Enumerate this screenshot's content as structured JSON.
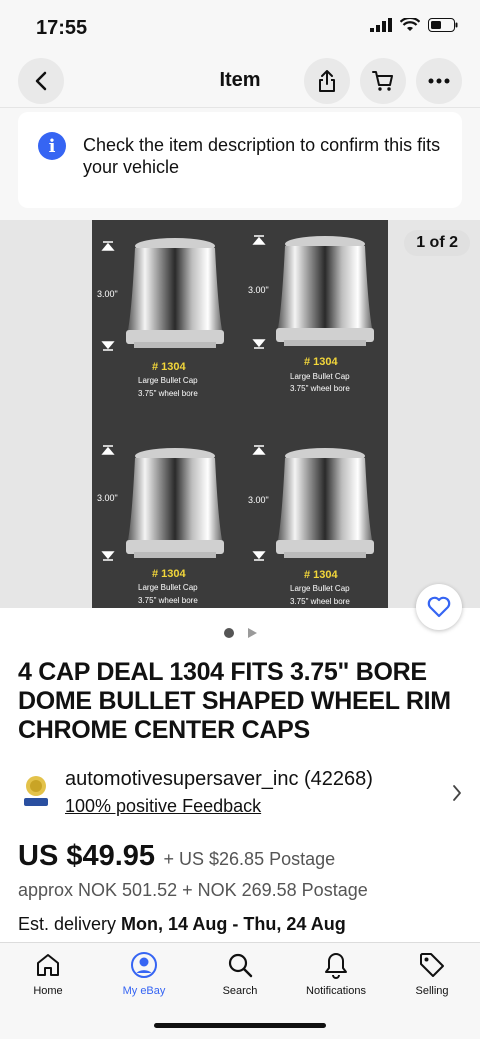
{
  "status": {
    "time": "17:55"
  },
  "nav": {
    "title": "Item",
    "icons": [
      "back-icon",
      "share-icon",
      "cart-icon",
      "more-icon"
    ]
  },
  "banner": {
    "text": "Check the item description to confirm this fits your vehicle"
  },
  "gallery": {
    "counter": "1 of 2",
    "image_labels": {
      "height": "3.00\"",
      "part_number": "# 1304",
      "line1": "Large Bullet Cap",
      "line2": "3.75\" wheel bore"
    }
  },
  "listing": {
    "title": "4 CAP DEAL 1304 FITS 3.75\" BORE DOME BULLET SHAPED WHEEL RIM CHROME CENTER CAPS",
    "seller_name": "automotivesupersaver_inc (42268)",
    "seller_feedback": "100% positive Feedback",
    "price": "US $49.95",
    "postage": "+ US $26.85 Postage",
    "approx": "approx NOK 501.52 + NOK 269.58 Postage",
    "delivery_prefix": "Est. delivery ",
    "delivery_dates": "Mon, 14 Aug - Thu, 24 Aug"
  },
  "tabs": [
    {
      "label": "Home",
      "icon": "home-icon"
    },
    {
      "label": "My eBay",
      "icon": "user-icon",
      "active": true
    },
    {
      "label": "Search",
      "icon": "search-icon"
    },
    {
      "label": "Notifications",
      "icon": "bell-icon"
    },
    {
      "label": "Selling",
      "icon": "tag-icon"
    }
  ],
  "colors": {
    "accent": "#3665f3",
    "product_bg": "#3b3b3b",
    "label_yellow": "#f2d63a"
  }
}
